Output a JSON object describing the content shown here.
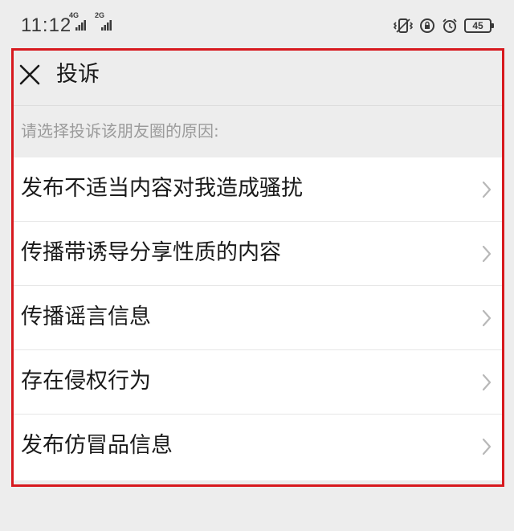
{
  "status_bar": {
    "time": "11:12",
    "signal_1": "4G",
    "signal_2": "2G",
    "battery": "45",
    "icons": [
      "vibrate-icon",
      "lock-rotation-icon",
      "alarm-icon",
      "battery-icon"
    ]
  },
  "header": {
    "title": "投诉",
    "close_icon": "close-icon"
  },
  "prompt": "请选择投诉该朋友圈的原因:",
  "items": [
    {
      "label": "发布不适当内容对我造成骚扰"
    },
    {
      "label": "传播带诱导分享性质的内容"
    },
    {
      "label": "传播谣言信息"
    },
    {
      "label": "存在侵权行为"
    },
    {
      "label": "发布仿冒品信息"
    }
  ],
  "colors": {
    "highlight_frame": "#d7191e",
    "background": "#ededed",
    "list_background": "#ffffff"
  }
}
